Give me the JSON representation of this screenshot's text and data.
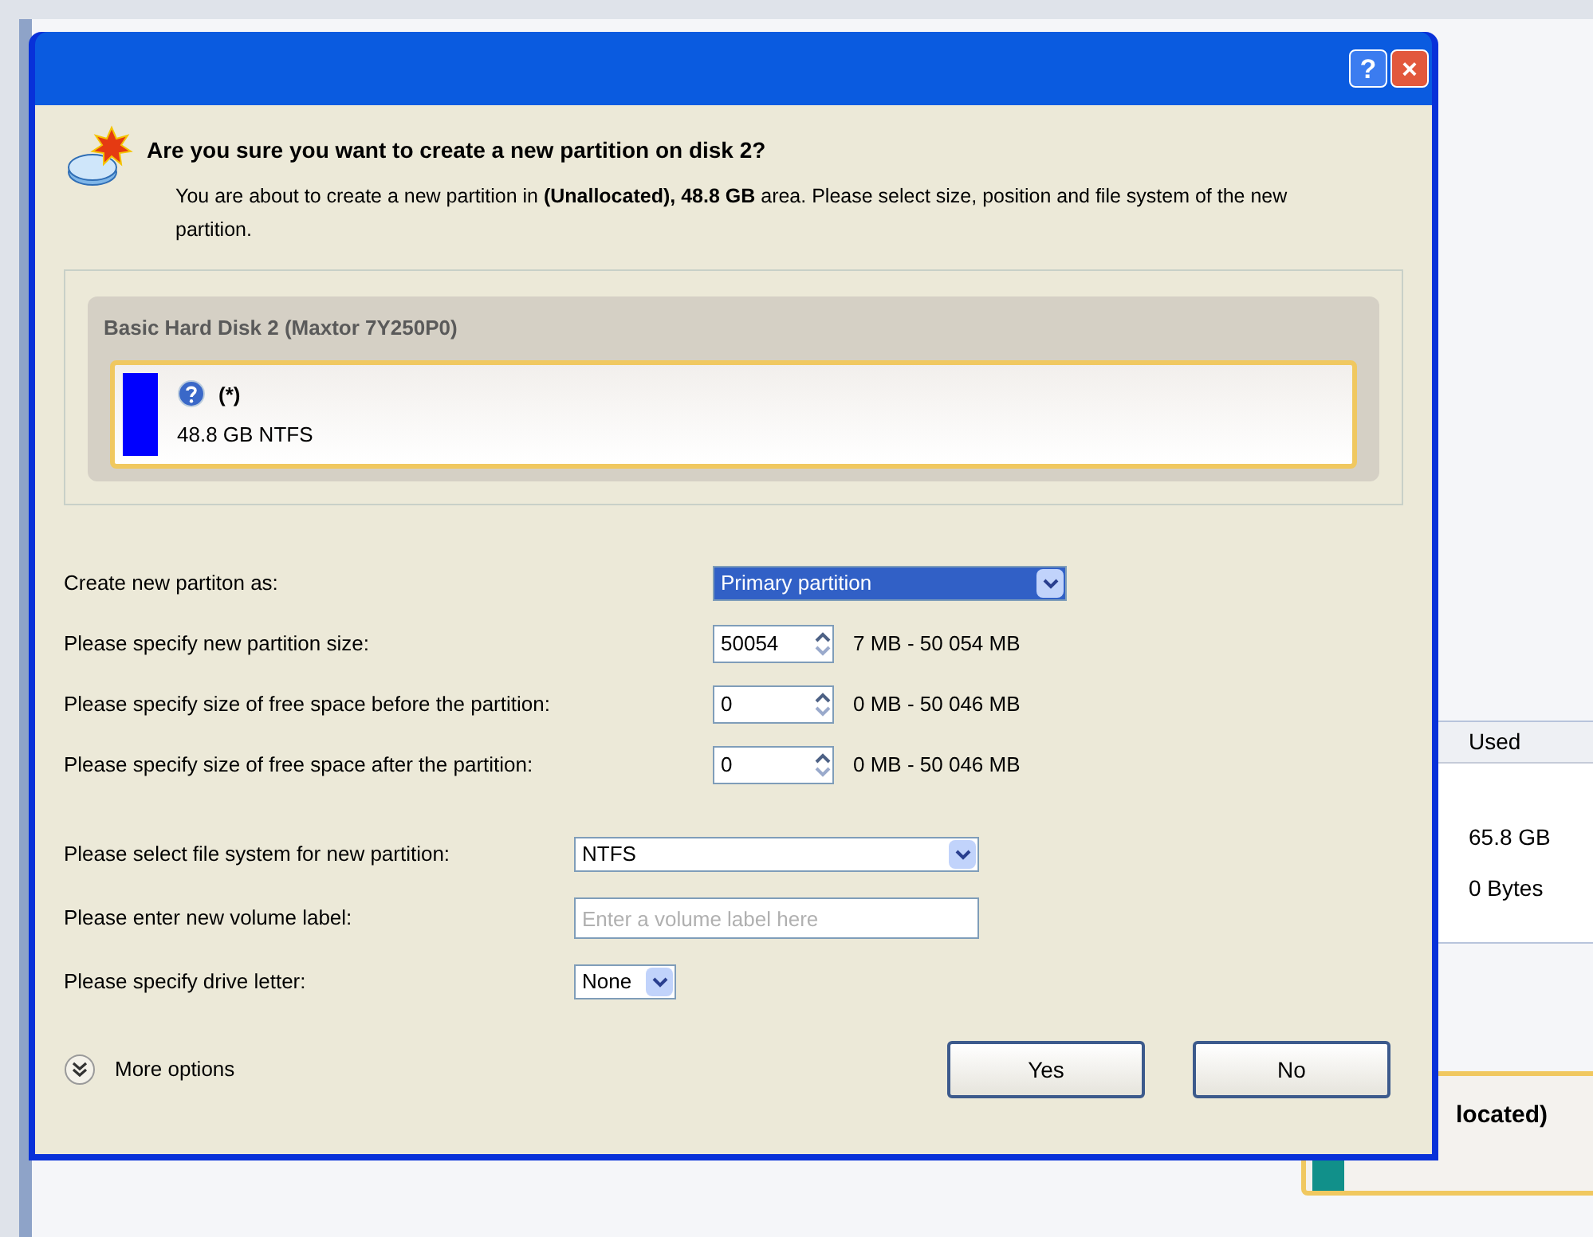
{
  "background_window": {
    "table": {
      "columns": [
        "Used"
      ],
      "rows": [
        [
          "65.8 GB"
        ],
        [
          "0 Bytes"
        ]
      ]
    },
    "partition_label": "located)"
  },
  "dialog": {
    "title_buttons": [
      {
        "kind": "help",
        "label": "?"
      },
      {
        "kind": "close",
        "label": "×"
      }
    ],
    "heading": "Are you sure you want to create a new partition on disk 2?",
    "message": "You are about to create a new partition in **(Unallocated), 48.8 GB** area. Please select size, position and file system of the new partition.",
    "disk": {
      "name": "Basic Hard Disk 2 (Maxtor 7Y250P0)",
      "partition": {
        "label": "(*)",
        "info": "48.8 GB NTFS",
        "color": "#0000ff",
        "selected": true
      }
    },
    "size_fields": [
      {
        "kind": "select",
        "label": "Create new partiton as:",
        "value": "Primary partition",
        "focused": true
      },
      {
        "kind": "spinner",
        "label": "Please specify new partition size:",
        "value": "50054",
        "range": "7 MB - 50 054 MB"
      },
      {
        "kind": "spinner",
        "label": "Please specify size of free space before the partition:",
        "value": "0",
        "range": "0 MB - 50 046 MB"
      },
      {
        "kind": "spinner",
        "label": "Please specify size of free space after the partition:",
        "value": "0",
        "range": "0 MB - 50 046 MB"
      }
    ],
    "fs_fields": [
      {
        "kind": "select",
        "label": "Please select file system for new partition:",
        "value": "NTFS"
      },
      {
        "kind": "text",
        "label": "Please enter new volume label:",
        "placeholder": "Enter a volume label here"
      },
      {
        "kind": "select",
        "label": "Please specify drive letter:",
        "value": "None"
      }
    ],
    "more_options": "More options",
    "buttons": [
      "Yes",
      "No"
    ]
  }
}
